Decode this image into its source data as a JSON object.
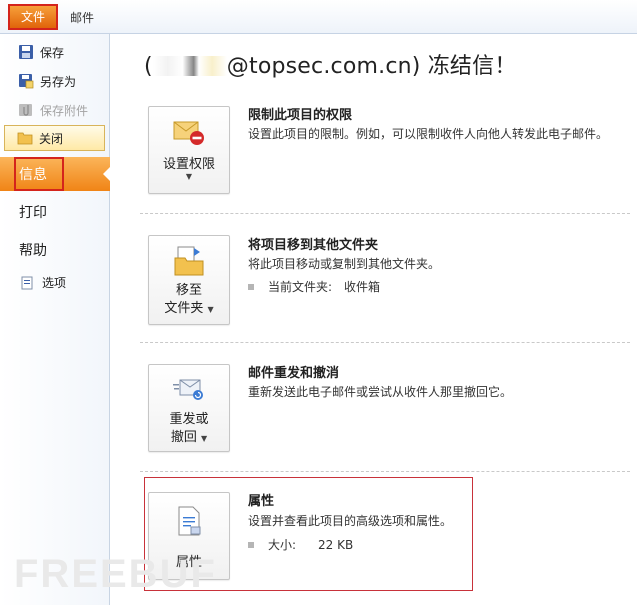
{
  "ribbon": {
    "file_tab": "文件",
    "mail_tab": "邮件"
  },
  "nav": {
    "save": "保存",
    "save_as": "另存为",
    "save_attachments": "保存附件",
    "close": "关闭",
    "info": "信息",
    "print": "打印",
    "help": "帮助",
    "options": "选项"
  },
  "main": {
    "title_prefix": "(",
    "title_suffix": "@topsec.com.cn) 冻结信！",
    "permissions": {
      "button_label": "设置权限",
      "heading": "限制此项目的权限",
      "description": "设置此项目的限制。例如，可以限制收件人向他人转发此电子邮件。"
    },
    "move": {
      "button_line1": "移至",
      "button_line2": "文件夹",
      "heading": "将项目移到其他文件夹",
      "description": "将此项目移动或复制到其他文件夹。",
      "current_folder_label": "当前文件夹:",
      "current_folder_value": "收件箱"
    },
    "resend": {
      "button_line1": "重发或",
      "button_line2": "撤回",
      "heading": "邮件重发和撤消",
      "description": "重新发送此电子邮件或尝试从收件人那里撤回它。"
    },
    "properties": {
      "button_label": "属性",
      "heading": "属性",
      "description": "设置并查看此项目的高级选项和属性。",
      "size_label": "大小:",
      "size_value": "22 KB"
    }
  },
  "watermark": "FREEBUF",
  "colors": {
    "accent_orange": "#f08416",
    "highlight_red": "#d4241c"
  }
}
